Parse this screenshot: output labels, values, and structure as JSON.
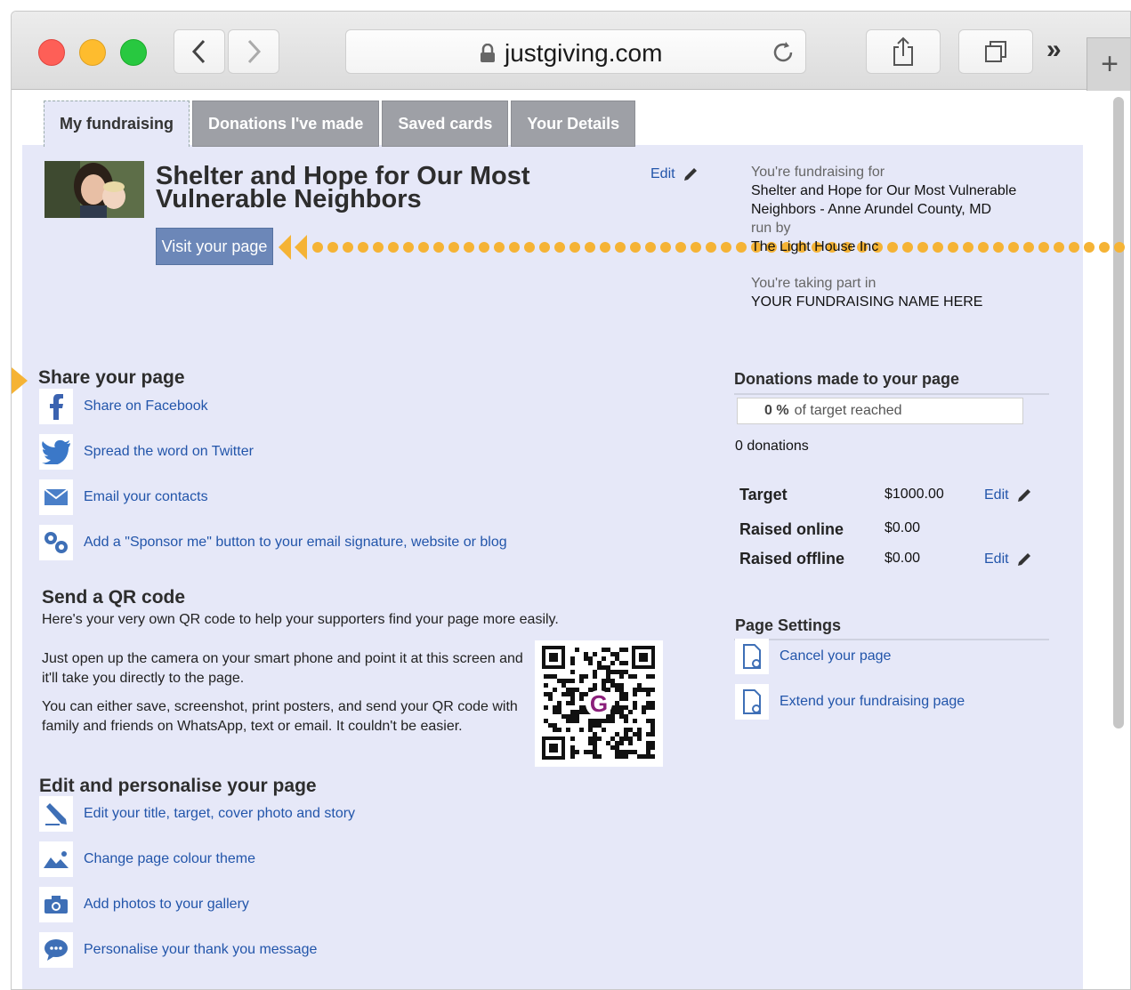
{
  "browser": {
    "url": "justgiving.com",
    "icons": [
      "back-icon",
      "forward-icon",
      "lock-icon",
      "reload-icon",
      "share-icon",
      "tabs-overview-icon",
      "more-chevrons-icon",
      "new-tab-icon"
    ],
    "more_label": "»",
    "new_tab_label": "+"
  },
  "tabs": [
    {
      "label": "My fundraising",
      "active": true
    },
    {
      "label": "Donations I've made",
      "active": false
    },
    {
      "label": "Saved cards",
      "active": false
    },
    {
      "label": "Your Details",
      "active": false
    }
  ],
  "page": {
    "title": "Shelter and Hope for Our Most Vulnerable Neighbors",
    "edit_label": "Edit",
    "visit_label": "Visit your page"
  },
  "fundraising_for": {
    "heading": "You're fundraising for",
    "cause": "Shelter and Hope for Our Most Vulnerable Neighbors - Anne Arundel County, MD",
    "run_by_label": "run by",
    "charity": "The Light House Inc",
    "taking_part_heading": "You're taking part in",
    "event": "YOUR FUNDRAISING NAME HERE"
  },
  "share": {
    "heading": "Share your page",
    "items": [
      {
        "label": "Share on Facebook",
        "icon": "facebook-icon"
      },
      {
        "label": "Spread the word on Twitter",
        "icon": "twitter-icon"
      },
      {
        "label": "Email your contacts",
        "icon": "email-icon"
      },
      {
        "label": "Add a \"Sponsor me\" button to your email signature, website or blog",
        "icon": "gears-icon"
      }
    ]
  },
  "qr": {
    "heading": "Send a QR code",
    "intro": "Here's your very own QR code to help your supporters find your page more easily.",
    "para1": "Just open up the camera on your smart phone and point it at this screen and it'll take you directly to the page.",
    "para2": "You can either save, screenshot, print posters, and send your QR code with family and friends on WhatsApp, text or email. It couldn't be easier.",
    "logo_letter": "G"
  },
  "personalise": {
    "heading": "Edit and personalise your page",
    "items": [
      {
        "label": "Edit your title, target, cover photo and story",
        "icon": "pencil-icon"
      },
      {
        "label": "Change page colour theme",
        "icon": "image-icon"
      },
      {
        "label": "Add photos to your gallery",
        "icon": "camera-icon"
      },
      {
        "label": "Personalise your thank you message",
        "icon": "chat-bubble-icon"
      }
    ]
  },
  "donations": {
    "heading": "Donations made to your page",
    "progress_percent": "0 %",
    "progress_label": "of target reached",
    "count_label": "0 donations",
    "stats": [
      {
        "label": "Target",
        "value": "$1000.00",
        "editable": true
      },
      {
        "label": "Raised online",
        "value": "$0.00",
        "editable": false
      },
      {
        "label": "Raised offline",
        "value": "$0.00",
        "editable": true
      }
    ],
    "edit_label": "Edit"
  },
  "settings": {
    "heading": "Page Settings",
    "items": [
      {
        "label": "Cancel your page",
        "icon": "document-icon"
      },
      {
        "label": "Extend your fundraising page",
        "icon": "document-icon"
      }
    ]
  },
  "colors": {
    "panel": "#e6e8f8",
    "link": "#2255aa",
    "button": "#6c87b8",
    "highlight": "#f5b335"
  }
}
